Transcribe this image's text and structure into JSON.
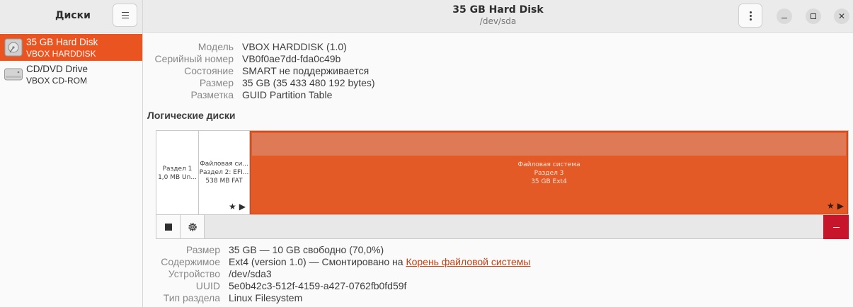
{
  "header": {
    "app_title": "Диски",
    "title": "35 GB Hard Disk",
    "subtitle": "/dev/sda"
  },
  "sidebar": {
    "items": [
      {
        "name": "35 GB Hard Disk",
        "model": "VBOX HARDDISK",
        "icon": "hard-disk-icon"
      },
      {
        "name": "CD/DVD Drive",
        "model": "VBOX CD-ROM",
        "icon": "optical-drive-icon"
      }
    ]
  },
  "disk_info": {
    "model_label": "Модель",
    "model": "VBOX HARDDISK (1.0)",
    "serial_label": "Серийный номер",
    "serial": "VB0f0ae7dd-fda0c49b",
    "state_label": "Состояние",
    "state": "SMART не поддерживается",
    "size_label": "Размер",
    "size": "35 GB (35 433 480 192 bytes)",
    "partitioning_label": "Разметка",
    "partitioning": "GUID Partition Table"
  },
  "volumes": {
    "title": "Логические диски",
    "partitions": [
      {
        "line1": "Раздел 1",
        "line2": "1,0 MB Un..."
      },
      {
        "line1": "Файловая си...",
        "line2": "Раздел 2: EFI...",
        "line3": "538 MB FAT"
      },
      {
        "line1": "Файловая система",
        "line2": "Раздел 3",
        "line3": "35 GB Ext4"
      }
    ],
    "icons": {
      "star": "★",
      "play": "▶"
    }
  },
  "volume_info": {
    "size_label": "Размер",
    "size": "35 GB — 10 GB свободно (70,0%)",
    "contents_label": "Содержимое",
    "contents": "Ext4 (version 1.0) — Смонтировано на ",
    "contents_link": "Корень файловой системы",
    "device_label": "Устройство",
    "device": "/dev/sda3",
    "uuid_label": "UUID",
    "uuid": "5e0b42c3-512f-4159-a427-0762fb0fd59f",
    "type_label": "Тип раздела",
    "type": "Linux Filesystem"
  },
  "colors": {
    "accent": "#e95420",
    "danger": "#c7162b"
  }
}
